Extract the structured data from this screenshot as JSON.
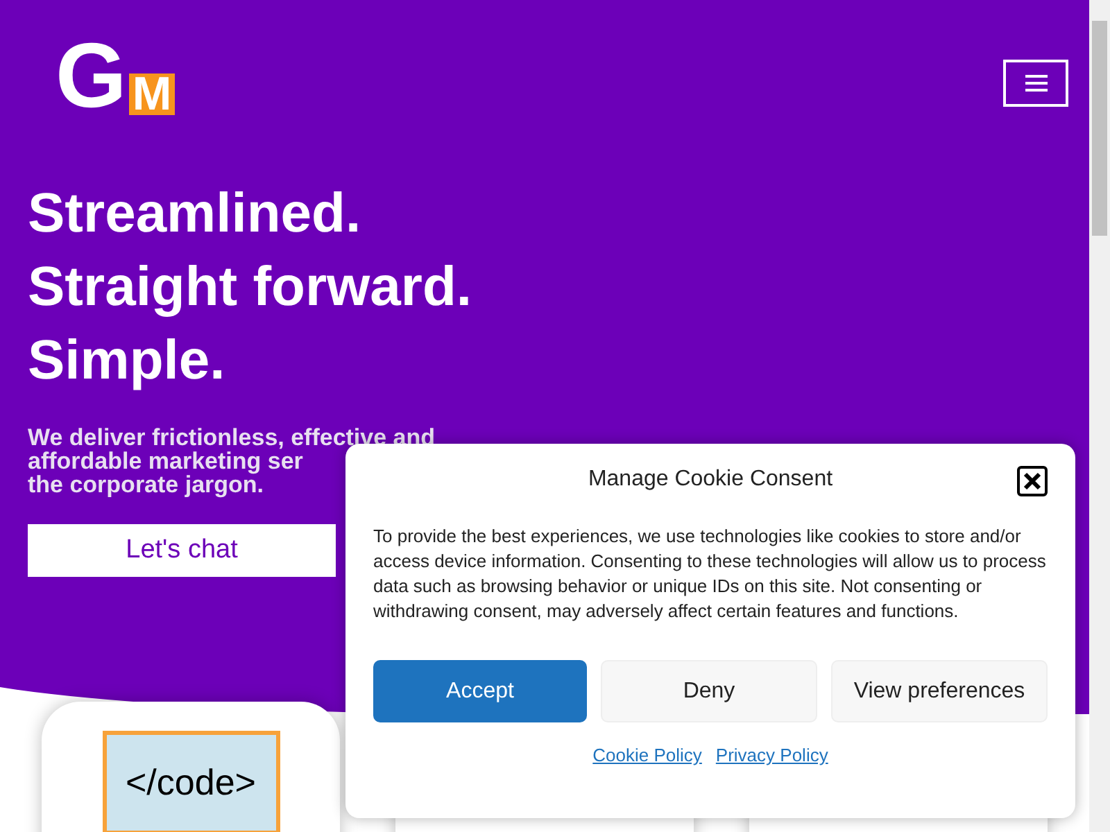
{
  "logo": {
    "letter_1": "G",
    "letter_2": "M"
  },
  "hero": {
    "headline": [
      "Streamlined.",
      "Straight forward.",
      "Simple."
    ],
    "subtitle": [
      "We deliver frictionless, effective and",
      "affordable marketing ser",
      "the corporate jargon."
    ],
    "cta": "Let's chat"
  },
  "cards": [
    {
      "kind": "code",
      "label": "</code>"
    },
    {
      "kind": "blank"
    },
    {
      "kind": "blank"
    }
  ],
  "cookie_dialog": {
    "title": "Manage Cookie Consent",
    "body": "To provide the best experiences, we use technologies like cookies to store and/or access device information. Consenting to these technologies will allow us to process data such as browsing behavior or unique IDs on this site. Not consenting or withdrawing consent, may adversely affect certain features and functions.",
    "buttons": [
      {
        "label": "Accept",
        "kind": "primary"
      },
      {
        "label": "Deny",
        "kind": "secondary"
      },
      {
        "label": "View preferences",
        "kind": "secondary"
      }
    ],
    "links": [
      "Cookie Policy",
      "Privacy Policy"
    ]
  }
}
